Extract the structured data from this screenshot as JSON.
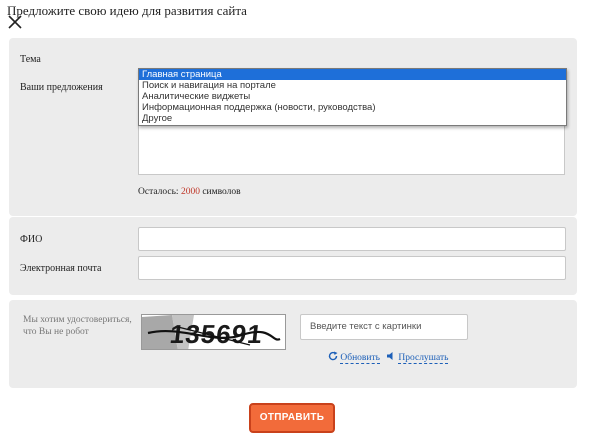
{
  "header": {
    "title": "Предложите свою идею для развития сайта"
  },
  "form": {
    "topic_label": "Тема",
    "suggestions_label": "Ваши предложения",
    "topic_options": [
      "Главная страница",
      "Поиск и навигация на портале",
      "Аналитические виджеты",
      "Информационная поддержка (новости, руководства)",
      "Другое"
    ],
    "selected_option_index": 0,
    "remaining_prefix": "Осталось:",
    "remaining_count": "2000",
    "remaining_suffix": "символов",
    "fio_label": "ФИО",
    "fio_value": "",
    "email_label": "Электронная почта",
    "email_value": ""
  },
  "captcha": {
    "robot_text": "Мы хотим удостовериться, что Вы не робот",
    "image_text": "135691",
    "input_placeholder": "Введите текст с картинки",
    "refresh_label": "Обновить",
    "listen_label": "Прослушать"
  },
  "submit_label": "ОТПРАВИТЬ",
  "colors": {
    "accent": "#f26b3a",
    "selected": "#1e6fd9",
    "counter": "#c0392b",
    "link": "#1c5fb8"
  },
  "icons": {
    "close": "close-icon",
    "refresh": "refresh-icon",
    "listen": "speaker-icon"
  }
}
